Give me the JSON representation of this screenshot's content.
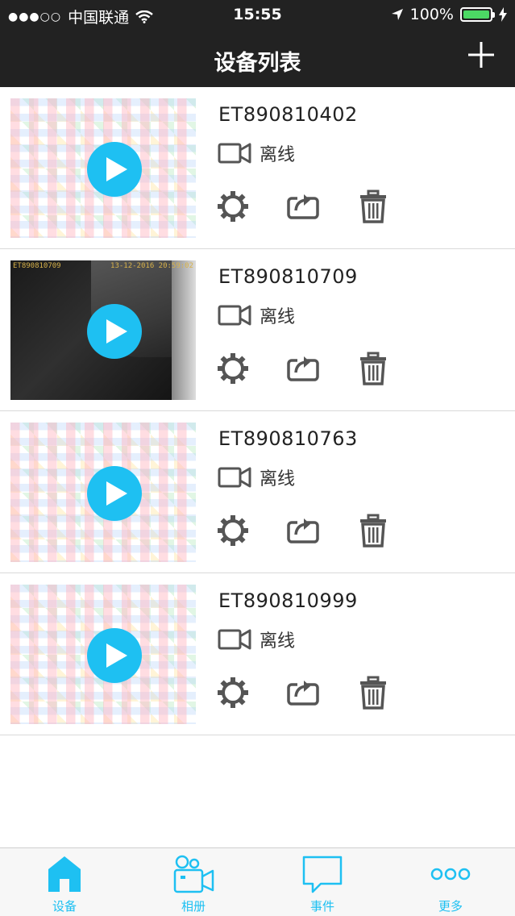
{
  "status_bar": {
    "carrier": "中国联通",
    "time": "15:55",
    "battery": "100%"
  },
  "nav": {
    "title": "设备列表",
    "add_icon": "plus-icon"
  },
  "devices": [
    {
      "id": "ET890810402",
      "status": "离线",
      "thumbnail": "mosaic"
    },
    {
      "id": "ET890810709",
      "status": "离线",
      "thumbnail": "camera",
      "stamp_left": "ET890810709",
      "stamp_right": "13-12-2016 20:59:02"
    },
    {
      "id": "ET890810763",
      "status": "离线",
      "thumbnail": "mosaic"
    },
    {
      "id": "ET890810999",
      "status": "离线",
      "thumbnail": "mosaic"
    }
  ],
  "tabs": [
    {
      "label": "设备",
      "icon": "home-icon"
    },
    {
      "label": "相册",
      "icon": "video-camera-icon"
    },
    {
      "label": "事件",
      "icon": "chat-bubble-icon"
    },
    {
      "label": "更多",
      "icon": "more-dots-icon"
    }
  ],
  "colors": {
    "accent": "#1ec0f2",
    "bar": "#222222",
    "battery": "#4cd964"
  }
}
